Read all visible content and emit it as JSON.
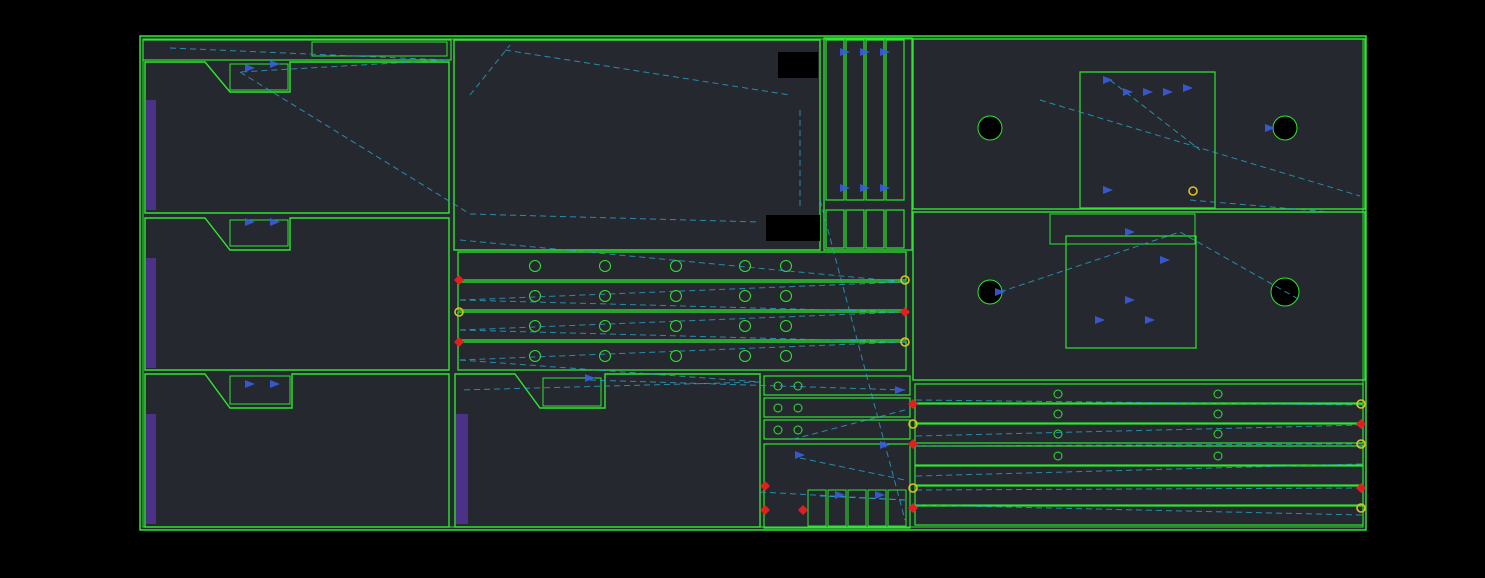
{
  "view": {
    "background": "#000000",
    "sheet_fill": "#262830",
    "part_outline": "#2ee62e",
    "toolpath": "#3a5ce0",
    "rapid_move": "#25a6c8",
    "feature_marker": "#9a5ad0",
    "pierce_marker": "#e02020",
    "start_marker": "#e0c020",
    "dim_block": "#000000"
  },
  "sheet": {
    "part_count": 16
  }
}
